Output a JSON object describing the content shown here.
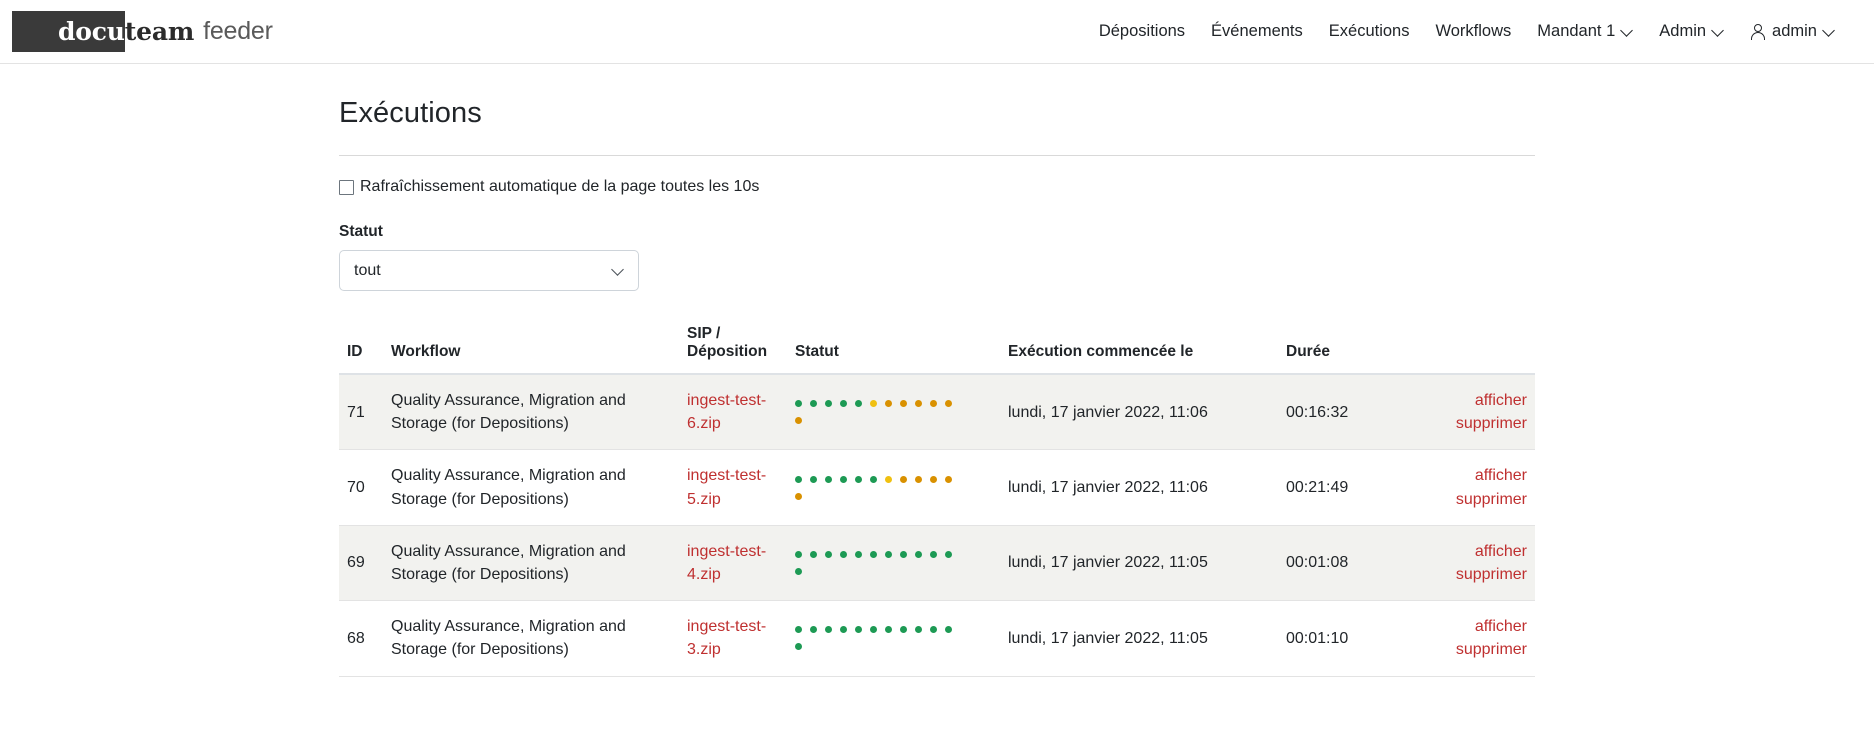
{
  "header": {
    "brand": {
      "part1": "docu",
      "part2": "team",
      "part3": "feeder"
    },
    "nav_items": [
      {
        "label": "Dépositions",
        "name": "nav-depositions",
        "caret": false,
        "person": false
      },
      {
        "label": "Événements",
        "name": "nav-evenements",
        "caret": false,
        "person": false
      },
      {
        "label": "Exécutions",
        "name": "nav-executions",
        "caret": false,
        "person": false
      },
      {
        "label": "Workflows",
        "name": "nav-workflows",
        "caret": false,
        "person": false
      },
      {
        "label": "Mandant 1",
        "name": "nav-mandant",
        "caret": true,
        "person": false
      },
      {
        "label": "Admin",
        "name": "nav-admin",
        "caret": true,
        "person": false
      },
      {
        "label": "admin",
        "name": "nav-user",
        "caret": true,
        "person": true
      }
    ]
  },
  "page": {
    "title": "Exécutions",
    "autorefresh_label": "Rafraîchissement automatique de la page toutes les 10s",
    "autorefresh_checked": false,
    "status_filter_label": "Statut",
    "status_filter_value": "tout",
    "status_filter_options": [
      "tout"
    ]
  },
  "table": {
    "headers": {
      "id": "ID",
      "workflow": "Workflow",
      "sip": "SIP / Déposition",
      "statut": "Statut",
      "started": "Exécution commencée le",
      "duration": "Durée",
      "actions": ""
    },
    "actions": {
      "view": "afficher",
      "delete": "supprimer"
    },
    "colors": {
      "green": "#1d9a54",
      "yellow": "#f0c010",
      "orange": "#d99100",
      "link": "#bf3030"
    },
    "rows": [
      {
        "id": "71",
        "workflow": "Quality Assurance, Migration and Storage (for Depositions)",
        "sip": "ingest-test-6.zip",
        "dots": [
          "green",
          "green",
          "green",
          "green",
          "green",
          "yellow",
          "orange",
          "orange",
          "orange",
          "orange",
          "orange",
          "orange"
        ],
        "started": "lundi, 17 janvier 2022, 11:06",
        "duration": "00:16:32",
        "striped": true
      },
      {
        "id": "70",
        "workflow": "Quality Assurance, Migration and Storage (for Depositions)",
        "sip": "ingest-test-5.zip",
        "dots": [
          "green",
          "green",
          "green",
          "green",
          "green",
          "green",
          "yellow",
          "orange",
          "orange",
          "orange",
          "orange",
          "orange"
        ],
        "started": "lundi, 17 janvier 2022, 11:06",
        "duration": "00:21:49",
        "striped": false
      },
      {
        "id": "69",
        "workflow": "Quality Assurance, Migration and Storage (for Depositions)",
        "sip": "ingest-test-4.zip",
        "dots": [
          "green",
          "green",
          "green",
          "green",
          "green",
          "green",
          "green",
          "green",
          "green",
          "green",
          "green",
          "green"
        ],
        "started": "lundi, 17 janvier 2022, 11:05",
        "duration": "00:01:08",
        "striped": true
      },
      {
        "id": "68",
        "workflow": "Quality Assurance, Migration and Storage (for Depositions)",
        "sip": "ingest-test-3.zip",
        "dots": [
          "green",
          "green",
          "green",
          "green",
          "green",
          "green",
          "green",
          "green",
          "green",
          "green",
          "green",
          "green"
        ],
        "started": "lundi, 17 janvier 2022, 11:05",
        "duration": "00:01:10",
        "striped": false
      }
    ]
  }
}
